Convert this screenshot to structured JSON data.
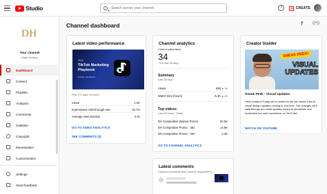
{
  "topbar": {
    "logo_text": "Studio",
    "search_placeholder": "Search across your channel",
    "help_icon": "?",
    "create_label": "CREATE"
  },
  "sidebar": {
    "channel_logo": "DH",
    "channel_title": "Your channel",
    "channel_name": "Dash Hudson",
    "items": [
      {
        "label": "Dashboard",
        "icon": "dashboard-icon"
      },
      {
        "label": "Content",
        "icon": "content-icon"
      },
      {
        "label": "Playlists",
        "icon": "playlists-icon"
      },
      {
        "label": "Analytics",
        "icon": "analytics-icon"
      },
      {
        "label": "Comments",
        "icon": "comments-icon"
      },
      {
        "label": "Subtitles",
        "icon": "subtitles-icon"
      },
      {
        "label": "Copyright",
        "icon": "copyright-icon"
      },
      {
        "label": "Monetization",
        "icon": "monetization-icon"
      },
      {
        "label": "Customization",
        "icon": "customization-icon"
      }
    ],
    "footer_items": [
      {
        "label": "Settings",
        "icon": "settings-icon"
      },
      {
        "label": "Send feedback",
        "icon": "feedback-icon"
      }
    ],
    "active_color": "#cc0000"
  },
  "main": {
    "title": "Channel dashboard",
    "live_icon": "((•))"
  },
  "video_card": {
    "title": "Latest video performance",
    "thumb_year": "2022",
    "thumb_title": "TikTok Marketing Playbook",
    "thumb_by": "DASH HUDSON",
    "period": "First 271 days 15 hours",
    "rows": [
      {
        "label": "Views",
        "value": "1.3K"
      },
      {
        "label": "Impressions click-through rate",
        "value": "10.7%"
      },
      {
        "label": "Average view duration",
        "value": "2:31"
      }
    ],
    "analytics_link": "GO TO VIDEO ANALYTICS",
    "comments_link": "SEE COMMENTS (3)"
  },
  "analytics_card": {
    "title": "Channel analytics",
    "subscribers_label": "Current subscribers",
    "subscribers_value": "34",
    "subscribers_change": "+3 in last 28 days",
    "summary_title": "Summary",
    "summary_period": "Last 28 days",
    "summary_rows": [
      {
        "label": "Views",
        "value": "638",
        "change": "▼ 9K"
      },
      {
        "label": "Watch time (hours)",
        "value": "6.4K",
        "change": "▲ 6K"
      }
    ],
    "top_title": "Top videos",
    "top_period": "Last 48 hours · Views",
    "top_rows": [
      {
        "label": "DH Competitive Walmut Promo",
        "value": "60.5K"
      },
      {
        "label": "DH Competitive Promo · 30s",
        "value": "14.9K"
      },
      {
        "label": "DH Competitive Promo · 20s",
        "value": "2.3K"
      }
    ],
    "link": "GO TO CHANNEL ANALYTICS"
  },
  "insider_card": {
    "title": "Creator Insider",
    "badge": "SNEAK PEEK!",
    "headline": "VISUAL UPDATES",
    "video_title": "Sneak Peek - Visual Updates",
    "description": "Hello Insiders! Today we're excited to tell you about a set of visual design updates coming to YouTube. The changes we'll walk through are small updates meant to streamline and modernize the user experience on YouTube!",
    "link": "WATCH ON YOUTUBE"
  },
  "comments_card": {
    "title": "Latest comments",
    "subtitle": "Channel comments that I haven't responded to"
  }
}
